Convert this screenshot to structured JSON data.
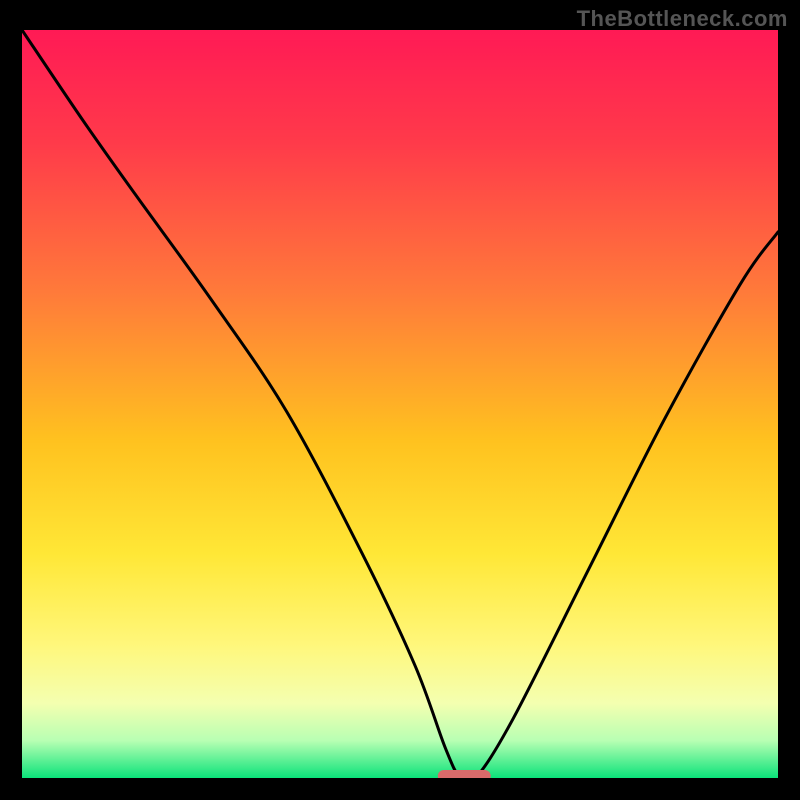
{
  "watermark": "TheBottleneck.com",
  "chart_data": {
    "type": "line",
    "title": "",
    "xlabel": "",
    "ylabel": "",
    "xlim": [
      0,
      100
    ],
    "ylim": [
      0,
      100
    ],
    "grid": false,
    "legend": false,
    "series": [
      {
        "name": "bottleneck-curve",
        "x": [
          0,
          8,
          15,
          25,
          35,
          45,
          52,
          56,
          58,
          60,
          65,
          75,
          85,
          95,
          100
        ],
        "values": [
          100,
          88,
          78,
          64,
          49,
          30,
          15,
          4,
          0,
          0,
          8,
          28,
          48,
          66,
          73
        ]
      }
    ],
    "minimum_marker": {
      "x_range": [
        55,
        62
      ],
      "y": 0,
      "color": "#d86a6a"
    },
    "background_gradient_stops": [
      {
        "offset": 0.0,
        "color": "#ff1a55"
      },
      {
        "offset": 0.15,
        "color": "#ff3a4a"
      },
      {
        "offset": 0.35,
        "color": "#ff7a3a"
      },
      {
        "offset": 0.55,
        "color": "#ffc21f"
      },
      {
        "offset": 0.7,
        "color": "#ffe736"
      },
      {
        "offset": 0.82,
        "color": "#fff77a"
      },
      {
        "offset": 0.9,
        "color": "#f4ffb0"
      },
      {
        "offset": 0.95,
        "color": "#b8ffb3"
      },
      {
        "offset": 1.0,
        "color": "#0be37a"
      }
    ]
  }
}
